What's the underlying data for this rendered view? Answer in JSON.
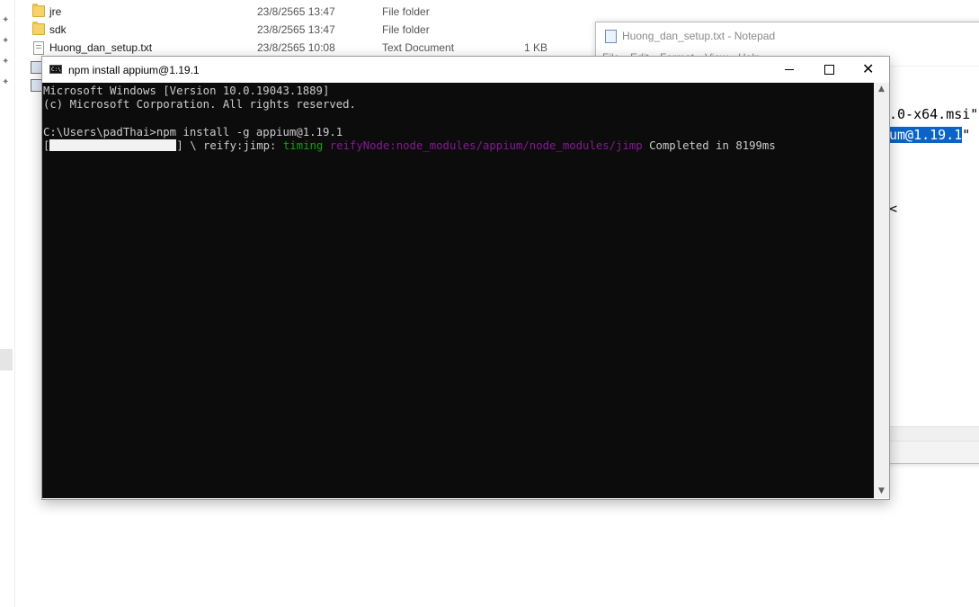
{
  "explorer": {
    "files": [
      {
        "name": "jre",
        "date": "23/8/2565 13:47",
        "type": "File folder",
        "size": "",
        "icon": "folder-icon"
      },
      {
        "name": "sdk",
        "date": "23/8/2565 13:47",
        "type": "File folder",
        "size": "",
        "icon": "folder-icon"
      },
      {
        "name": "Huong_dan_setup.txt",
        "date": "23/8/2565 10:08",
        "type": "Text Document",
        "size": "1 KB",
        "icon": "text-file-icon"
      }
    ]
  },
  "notepad": {
    "title": "Huong_dan_setup.txt - Notepad",
    "menu": [
      "File",
      "Edit",
      "Format",
      "View",
      "Help"
    ],
    "lines": {
      "line1": ".0-x64.msi\"",
      "line2_selected": "um@1.19.1",
      "line2_rest": "\"",
      "line3": "<"
    }
  },
  "console": {
    "title": "npm install appium@1.19.1",
    "icon_text": "C:\\",
    "buttons": {
      "minimize": "minimize",
      "maximize": "maximize",
      "close": "✕"
    },
    "lines": {
      "line1": "Microsoft Windows [Version 10.0.19043.1889]",
      "line2": "(c) Microsoft Corporation. All rights reserved.",
      "prompt": "C:\\Users\\padThai>npm install -g appium@1.19.1",
      "progress_open": "[",
      "progress_close": "] \\ reify:jimp: ",
      "timing": "timing",
      "module_path": "reifyNode:node_modules/appium/node_modules/jimp",
      "completed": " Completed in 8199ms"
    },
    "progress_fraction": 0.9,
    "colors": {
      "background": "#0c0c0c",
      "text": "#cccccc",
      "green": "#13a10e",
      "purple": "#881798"
    }
  }
}
